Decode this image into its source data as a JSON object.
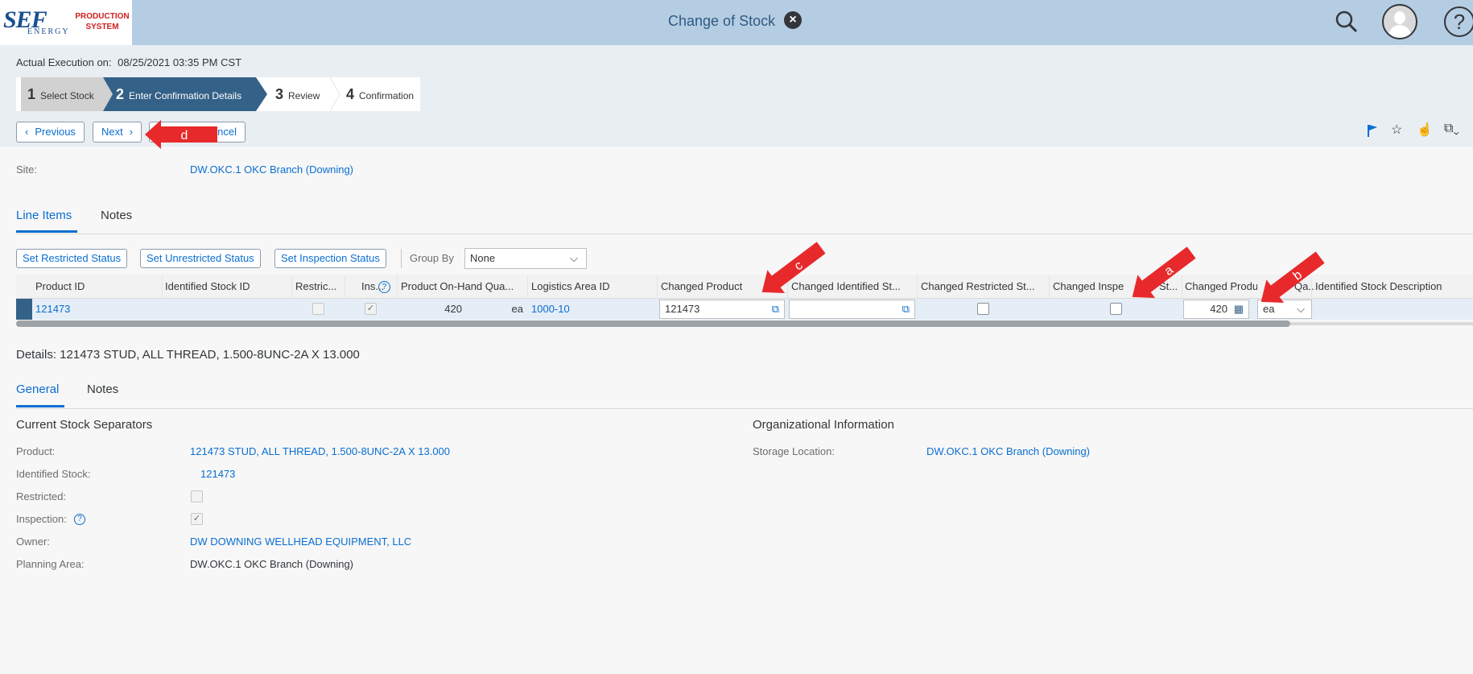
{
  "shell": {
    "logo_main": "SEF",
    "logo_sub": "ENERGY",
    "logo_prod": "PRODUCTION SYSTEM",
    "title": "Change of Stock"
  },
  "header": {
    "exec_label": "Actual Execution on:",
    "exec_value": "08/25/2021 03:35 PM CST",
    "steps": [
      {
        "num": "1",
        "label": "Select Stock"
      },
      {
        "num": "2",
        "label": "Enter Confirmation Details"
      },
      {
        "num": "3",
        "label": "Review"
      },
      {
        "num": "4",
        "label": "Confirmation"
      }
    ],
    "buttons": {
      "previous": "Previous",
      "next": "Next",
      "cancel": "ancel"
    }
  },
  "site": {
    "label": "Site:",
    "value": "DW.OKC.1 OKC Branch (Downing)"
  },
  "main_tabs": [
    "Line Items",
    "Notes"
  ],
  "table_toolbar": {
    "set_restricted": "Set Restricted Status",
    "set_unrestricted": "Set Unrestricted Status",
    "set_inspection": "Set Inspection Status",
    "group_by_label": "Group By",
    "group_by_value": "None"
  },
  "table": {
    "columns": [
      "Product ID",
      "Identified Stock ID",
      "Restric...",
      "Ins...",
      "Product On-Hand Qua...",
      "Logistics Area ID",
      "Changed Product",
      "Changed Identified St...",
      "Changed Restricted St...",
      "Changed Inspe",
      "St...",
      "Changed Produ",
      "Qa...",
      "Identified Stock Description"
    ],
    "row": {
      "product_id": "121473",
      "identified_stock_id": "",
      "restricted": false,
      "inspection": true,
      "on_hand_qty": "420",
      "on_hand_uom": "ea",
      "logistics_area": "1000-10",
      "changed_product": "121473",
      "changed_identified_stock": "",
      "changed_restricted": false,
      "changed_inspection": false,
      "changed_qty": "420",
      "changed_uom": "ea"
    }
  },
  "annotations": {
    "a": "a",
    "b": "b",
    "c": "c",
    "d": "d"
  },
  "details": {
    "title": "Details: 121473 STUD, ALL THREAD, 1.500-8UNC-2A X 13.000",
    "tabs": [
      "General",
      "Notes"
    ],
    "current_stock": {
      "title": "Current Stock Separators",
      "product_label": "Product:",
      "product_value": "121473 STUD, ALL THREAD, 1.500-8UNC-2A X 13.000",
      "identified_label": "Identified Stock:",
      "identified_value": "121473",
      "restricted_label": "Restricted:",
      "restricted": false,
      "inspection_label": "Inspection:",
      "inspection": true,
      "owner_label": "Owner:",
      "owner_value": "DW DOWNING WELLHEAD EQUIPMENT, LLC",
      "planning_label": "Planning Area:",
      "planning_value": "DW.OKC.1 OKC Branch (Downing)"
    },
    "org_info": {
      "title": "Organizational Information",
      "storage_label": "Storage Location:",
      "storage_value": "DW.OKC.1 OKC Branch (Downing)"
    }
  },
  "colors": {
    "shell_bg": "#b5cde3",
    "accent": "#0a6ed1",
    "step_active": "#346187",
    "arrow_red": "#e8292b"
  }
}
